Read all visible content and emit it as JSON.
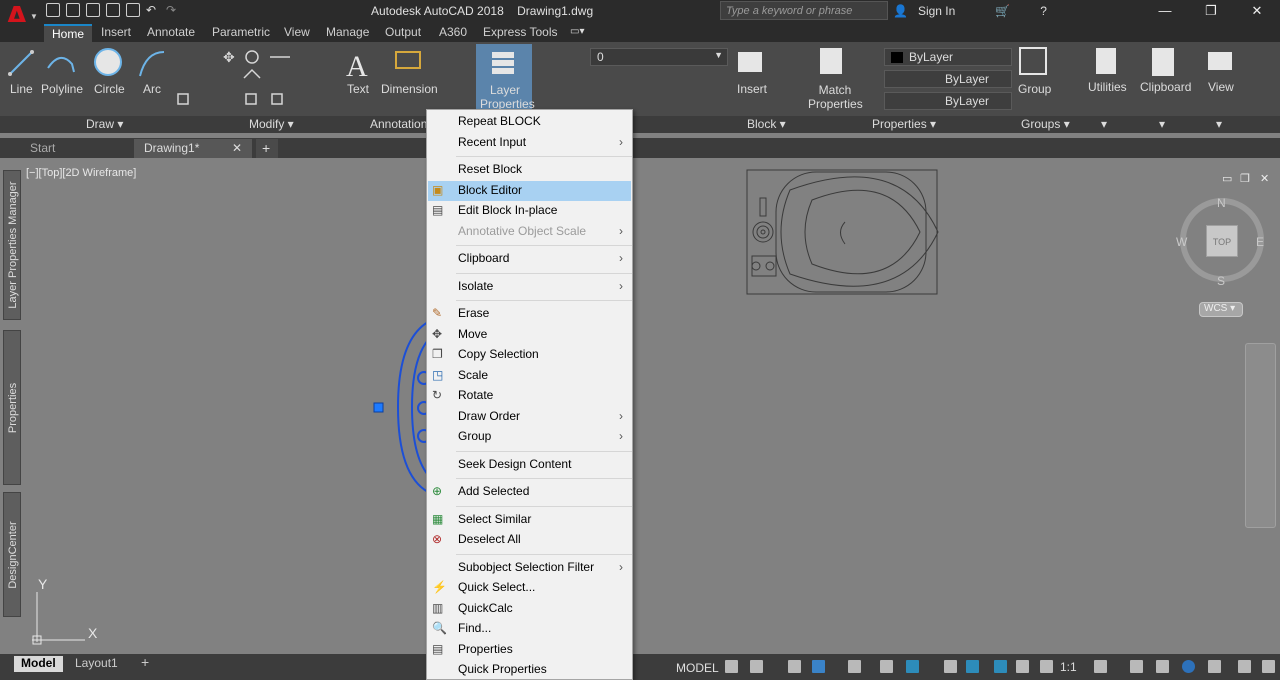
{
  "window": {
    "app_title": "Autodesk AutoCAD 2018",
    "file_title": "Drawing1.dwg",
    "search_placeholder": "Type a keyword or phrase",
    "sign_in": "Sign In"
  },
  "ribbon_tabs": [
    "Home",
    "Insert",
    "Annotate",
    "Parametric",
    "View",
    "Manage",
    "Output",
    "A360",
    "Express Tools"
  ],
  "ribbon": {
    "draw": {
      "line": "Line",
      "polyline": "Polyline",
      "circle": "Circle",
      "arc": "Arc",
      "panel": "Draw"
    },
    "modify": {
      "panel": "Modify"
    },
    "annotation": {
      "text": "Text",
      "dimension": "Dimension",
      "panel": "Annotation"
    },
    "layers": {
      "layer_properties_1": "Layer",
      "layer_properties_2": "Properties",
      "current_layer": "0"
    },
    "block": {
      "insert": "Insert",
      "panel": "Block"
    },
    "properties": {
      "match_1": "Match",
      "match_2": "Properties",
      "color": "ByLayer",
      "linetype": "ByLayer",
      "lineweight": "ByLayer",
      "panel": "Properties"
    },
    "groups": {
      "group": "Group",
      "panel": "Groups"
    },
    "utilities": "Utilities",
    "clipboard": "Clipboard",
    "view": "View"
  },
  "file_tabs": {
    "start": "Start",
    "drawing": "Drawing1*"
  },
  "viewport": {
    "label": "[−][Top][2D Wireframe]",
    "viewcube": {
      "n": "N",
      "s": "S",
      "e": "E",
      "w": "W",
      "top": "TOP",
      "wcs": "WCS"
    },
    "ucs_x": "X",
    "ucs_y": "Y"
  },
  "side_palettes": [
    "Layer Properties Manager",
    "Properties",
    "DesignCenter"
  ],
  "context_menu": [
    {
      "label": "Repeat BLOCK"
    },
    {
      "label": "Recent Input",
      "submenu": true
    },
    {
      "sep": true
    },
    {
      "label": "Reset Block"
    },
    {
      "label": "Block Editor",
      "highlighted": true,
      "icon": "block-editor-icon"
    },
    {
      "label": "Edit Block In-place",
      "icon": "edit-block-icon"
    },
    {
      "label": "Annotative Object Scale",
      "disabled": true,
      "submenu": true
    },
    {
      "sep": true
    },
    {
      "label": "Clipboard",
      "submenu": true
    },
    {
      "sep": true
    },
    {
      "label": "Isolate",
      "submenu": true
    },
    {
      "sep": true
    },
    {
      "label": "Erase",
      "icon": "erase-icon"
    },
    {
      "label": "Move",
      "icon": "move-icon"
    },
    {
      "label": "Copy Selection",
      "icon": "copy-icon"
    },
    {
      "label": "Scale",
      "icon": "scale-icon"
    },
    {
      "label": "Rotate",
      "icon": "rotate-icon"
    },
    {
      "label": "Draw Order",
      "submenu": true
    },
    {
      "label": "Group",
      "submenu": true
    },
    {
      "sep": true
    },
    {
      "label": "Seek Design Content"
    },
    {
      "sep": true
    },
    {
      "label": "Add Selected",
      "icon": "add-selected-icon"
    },
    {
      "sep": true
    },
    {
      "label": "Select Similar",
      "icon": "select-similar-icon"
    },
    {
      "label": "Deselect All",
      "icon": "deselect-icon"
    },
    {
      "sep": true
    },
    {
      "label": "Subobject Selection Filter",
      "submenu": true
    },
    {
      "label": "Quick Select...",
      "icon": "quick-select-icon"
    },
    {
      "label": "QuickCalc",
      "icon": "calculator-icon"
    },
    {
      "label": "Find...",
      "icon": "find-icon"
    },
    {
      "label": "Properties",
      "icon": "properties-icon"
    },
    {
      "label": "Quick Properties"
    }
  ],
  "status": {
    "model_tab": "Model",
    "layout_tab": "Layout1",
    "model_space": "MODEL",
    "scale": "1:1"
  },
  "colors": {
    "accent": "#1a86c8",
    "highlight": "#a8d1f2",
    "logo": "#d4141c"
  }
}
